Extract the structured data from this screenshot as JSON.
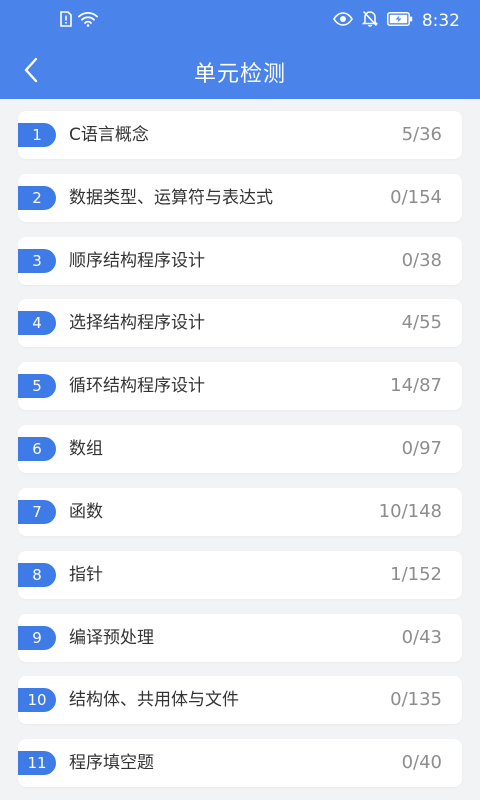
{
  "status_bar": {
    "time": "8:32"
  },
  "header": {
    "title": "单元检测"
  },
  "units": [
    {
      "num": "1",
      "name": "C语言概念",
      "progress": "5/36"
    },
    {
      "num": "2",
      "name": "数据类型、运算符与表达式",
      "progress": "0/154"
    },
    {
      "num": "3",
      "name": "顺序结构程序设计",
      "progress": "0/38"
    },
    {
      "num": "4",
      "name": "选择结构程序设计",
      "progress": "4/55"
    },
    {
      "num": "5",
      "name": "循环结构程序设计",
      "progress": "14/87"
    },
    {
      "num": "6",
      "name": "数组",
      "progress": "0/97"
    },
    {
      "num": "7",
      "name": "函数",
      "progress": "10/148"
    },
    {
      "num": "8",
      "name": "指针",
      "progress": "1/152"
    },
    {
      "num": "9",
      "name": "编译预处理",
      "progress": "0/43"
    },
    {
      "num": "10",
      "name": "结构体、共用体与文件",
      "progress": "0/135"
    },
    {
      "num": "11",
      "name": "程序填空题",
      "progress": "0/40"
    }
  ],
  "icons": {
    "back": "back-arrow-icon",
    "status": [
      "sim-alert-icon",
      "wifi-icon",
      "eye-icon",
      "bell-off-icon",
      "battery-charging-icon"
    ]
  },
  "colors": {
    "header": "#4a83ea",
    "badge": "#3f7be6",
    "background": "#f2f3f5",
    "card": "#ffffff"
  }
}
